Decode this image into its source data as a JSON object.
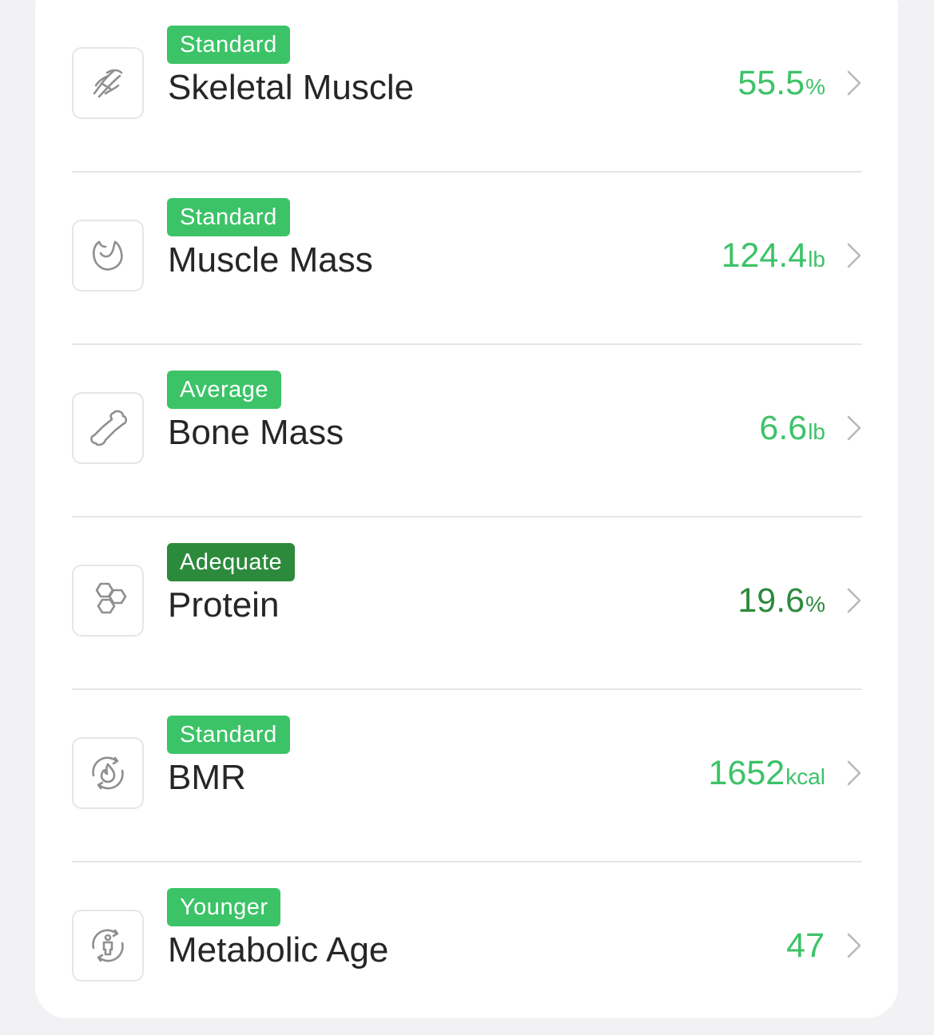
{
  "colors": {
    "green_light": "#3cc368",
    "green_dark": "#2c8a3c",
    "text": "#262626",
    "icon_stroke": "#8f8f8f",
    "chevron": "#b9b9b9"
  },
  "metrics": [
    {
      "status": "Standard",
      "status_color": "#3cc368",
      "label": "Skeletal Muscle",
      "value": "55.5",
      "unit": "%",
      "value_color": "#3cc368",
      "icon": "skeletal-muscle-icon"
    },
    {
      "status": "Standard",
      "status_color": "#3cc368",
      "label": "Muscle Mass",
      "value": "124.4",
      "unit": "lb",
      "value_color": "#3cc368",
      "icon": "muscle-mass-icon"
    },
    {
      "status": "Average",
      "status_color": "#3cc368",
      "label": "Bone Mass",
      "value": "6.6",
      "unit": "lb",
      "value_color": "#3cc368",
      "icon": "bone-icon"
    },
    {
      "status": "Adequate",
      "status_color": "#2c8a3c",
      "label": "Protein",
      "value": "19.6",
      "unit": "%",
      "value_color": "#2c8a3c",
      "icon": "protein-icon"
    },
    {
      "status": "Standard",
      "status_color": "#3cc368",
      "label": "BMR",
      "value": "1652",
      "unit": "kcal",
      "value_color": "#3cc368",
      "icon": "bmr-flame-icon"
    },
    {
      "status": "Younger",
      "status_color": "#3cc368",
      "label": "Metabolic Age",
      "value": "47",
      "unit": "",
      "value_color": "#3cc368",
      "icon": "metabolic-age-icon"
    }
  ]
}
